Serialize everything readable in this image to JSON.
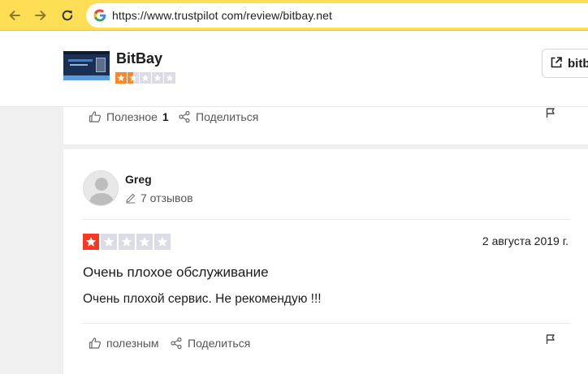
{
  "browser": {
    "url": "https://www.trustpilot com/review/bitbay.net",
    "back_icon": "arrow-left-icon",
    "forward_icon": "arrow-right-icon",
    "reload_icon": "reload-icon",
    "site_icon": "google-g-icon"
  },
  "company": {
    "name": "BitBay",
    "rating_stars": 2,
    "star_count": 5,
    "visit_label": "bitb"
  },
  "review_prev": {
    "helpful_label": "Полезное",
    "helpful_count": "1",
    "share_label": "Поделиться"
  },
  "review": {
    "reviewer_name": "Greg",
    "reviews_count": "7 отзывов",
    "rating_stars": 1,
    "date": "2 августа 2019 г.",
    "title": "Очень плохое обслуживание",
    "body": "Очень плохой сервис. Не рекомендую !!!",
    "helpful_label": "полезным",
    "share_label": "Поделиться"
  },
  "colors": {
    "chrome_bar": "#fdde55",
    "star_two": "#ff8622",
    "star_one": "#ff3722",
    "star_empty": "#dcdce6"
  }
}
